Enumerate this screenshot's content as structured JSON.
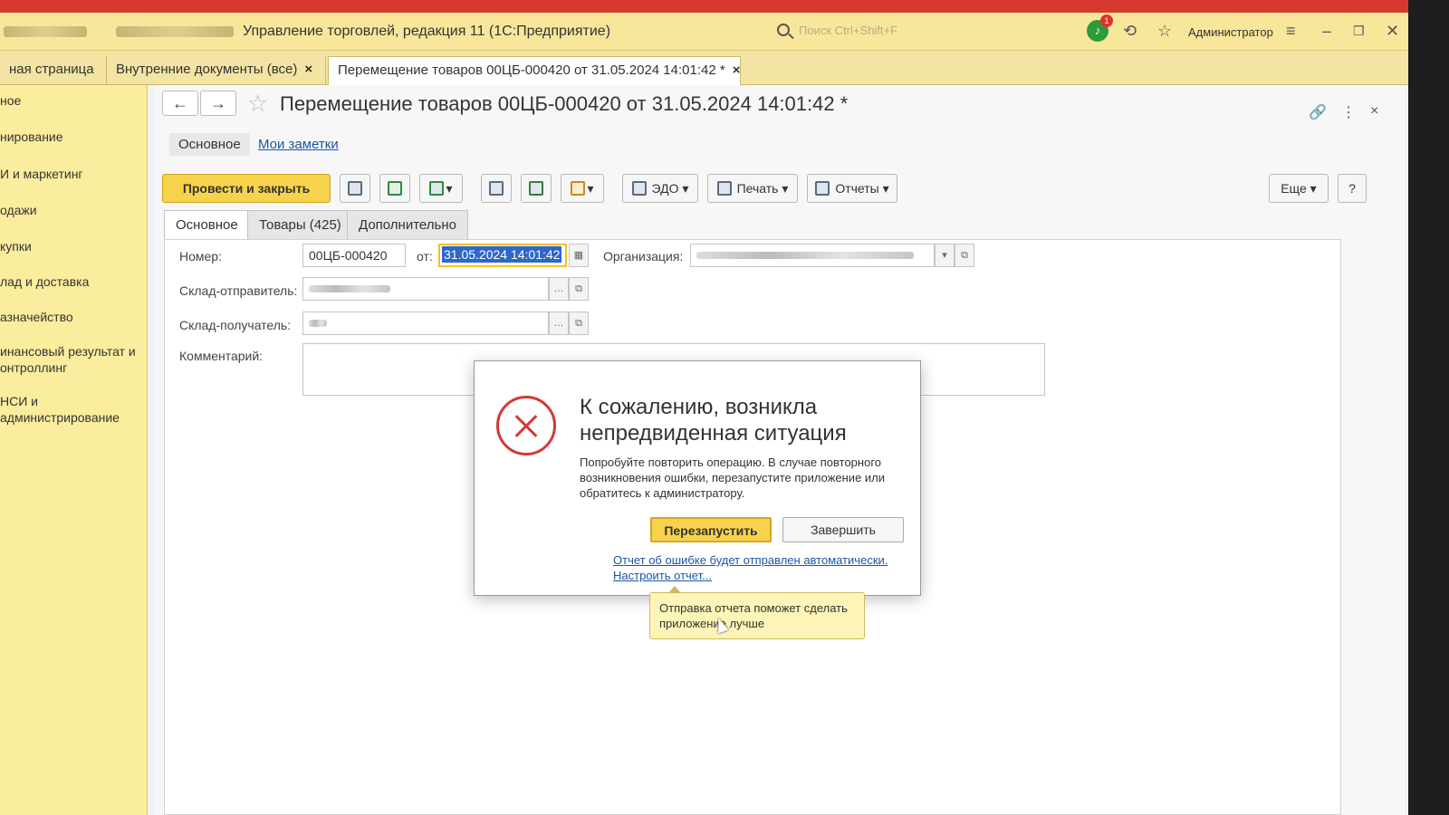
{
  "window": {
    "app_title": "Управление торговлей, редакция 11  (1С:Предприятие)",
    "search_placeholder": "Поиск Ctrl+Shift+F",
    "notifications_count": "1",
    "user": "Администратор"
  },
  "tabs": [
    {
      "label": "ная страница"
    },
    {
      "label": "Внутренние документы (все)"
    },
    {
      "label": "Перемещение товаров 00ЦБ-000420 от 31.05.2024 14:01:42 *"
    }
  ],
  "sidebar": {
    "items": [
      {
        "label": "ное"
      },
      {
        "label": "нирование"
      },
      {
        "label": "И и маркетинг"
      },
      {
        "label": "одажи"
      },
      {
        "label": "купки"
      },
      {
        "label": "лад и доставка"
      },
      {
        "label": "азначейство"
      },
      {
        "label": "инансовый результат и"
      },
      {
        "label": "онтроллинг"
      },
      {
        "label": "НСИ и"
      },
      {
        "label": "администрирование"
      }
    ]
  },
  "document": {
    "title": "Перемещение товаров 00ЦБ-000420 от 31.05.2024 14:01:42 *",
    "subtabs": {
      "main": "Основное",
      "notes": "Мои заметки"
    },
    "toolbar": {
      "post_close": "Провести и закрыть",
      "edo": "ЭДО",
      "print": "Печать",
      "reports": "Отчеты",
      "more": "Еще",
      "help": "?"
    },
    "form_tabs": [
      {
        "label": "Основное"
      },
      {
        "label": "Товары (425)"
      },
      {
        "label": "Дополнительно"
      }
    ],
    "fields": {
      "number_label": "Номер:",
      "number_value": "00ЦБ-000420",
      "date_label": "от:",
      "date_value": "31.05.2024 14:01:42",
      "org_label": "Организация:",
      "sender_label": "Склад-отправитель:",
      "receiver_label": "Склад-получатель:",
      "comment_label": "Комментарий:"
    }
  },
  "dialog": {
    "title": "К сожалению, возникла непредвиденная ситуация",
    "message": "Попробуйте повторить операцию. В случае повторного возникновения ошибки, перезапустите приложение или обратитесь к администратору.",
    "restart_label": "Перезапустить",
    "finish_label": "Завершить",
    "report_link": "Отчет об ошибке будет отправлен автоматически.",
    "configure_link": "Настроить отчет...",
    "tooltip": "Отправка отчета поможет сделать приложение лучше"
  }
}
